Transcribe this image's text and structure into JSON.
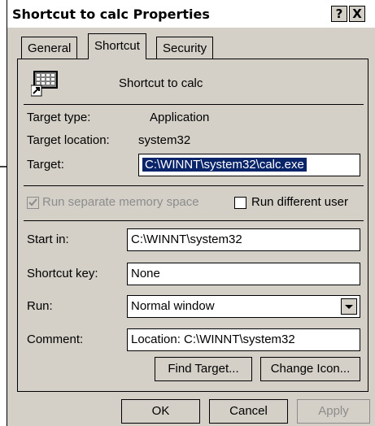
{
  "window": {
    "title": "Shortcut to calc Properties",
    "help_label": "?",
    "close_label": "X"
  },
  "tabs": [
    {
      "label": "General"
    },
    {
      "label": "Shortcut"
    },
    {
      "label": "Security"
    }
  ],
  "header": {
    "name": "Shortcut to calc",
    "icon": "calculator-shortcut-icon"
  },
  "info": {
    "target_type_label": "Target type:",
    "target_type_value": "Application",
    "target_location_label": "Target location:",
    "target_location_value": "system32"
  },
  "target": {
    "label": "Target:",
    "value": "C:\\WINNT\\system32\\calc.exe"
  },
  "options": {
    "separate_memory_label": "Run separate memory space",
    "separate_memory_checked": true,
    "different_user_label": "Run different user",
    "different_user_checked": false
  },
  "start_in": {
    "label": "Start in:",
    "value": "C:\\WINNT\\system32"
  },
  "shortcut_key": {
    "label": "Shortcut key:",
    "value": "None"
  },
  "run": {
    "label": "Run:",
    "value": "Normal window"
  },
  "comment": {
    "label": "Comment:",
    "value": "Location: C:\\WINNT\\system32"
  },
  "buttons": {
    "find_target": "Find Target...",
    "change_icon": "Change Icon...",
    "ok": "OK",
    "cancel": "Cancel",
    "apply": "Apply"
  },
  "colors": {
    "selection": "#0a246a",
    "face": "#d4d0c8"
  }
}
